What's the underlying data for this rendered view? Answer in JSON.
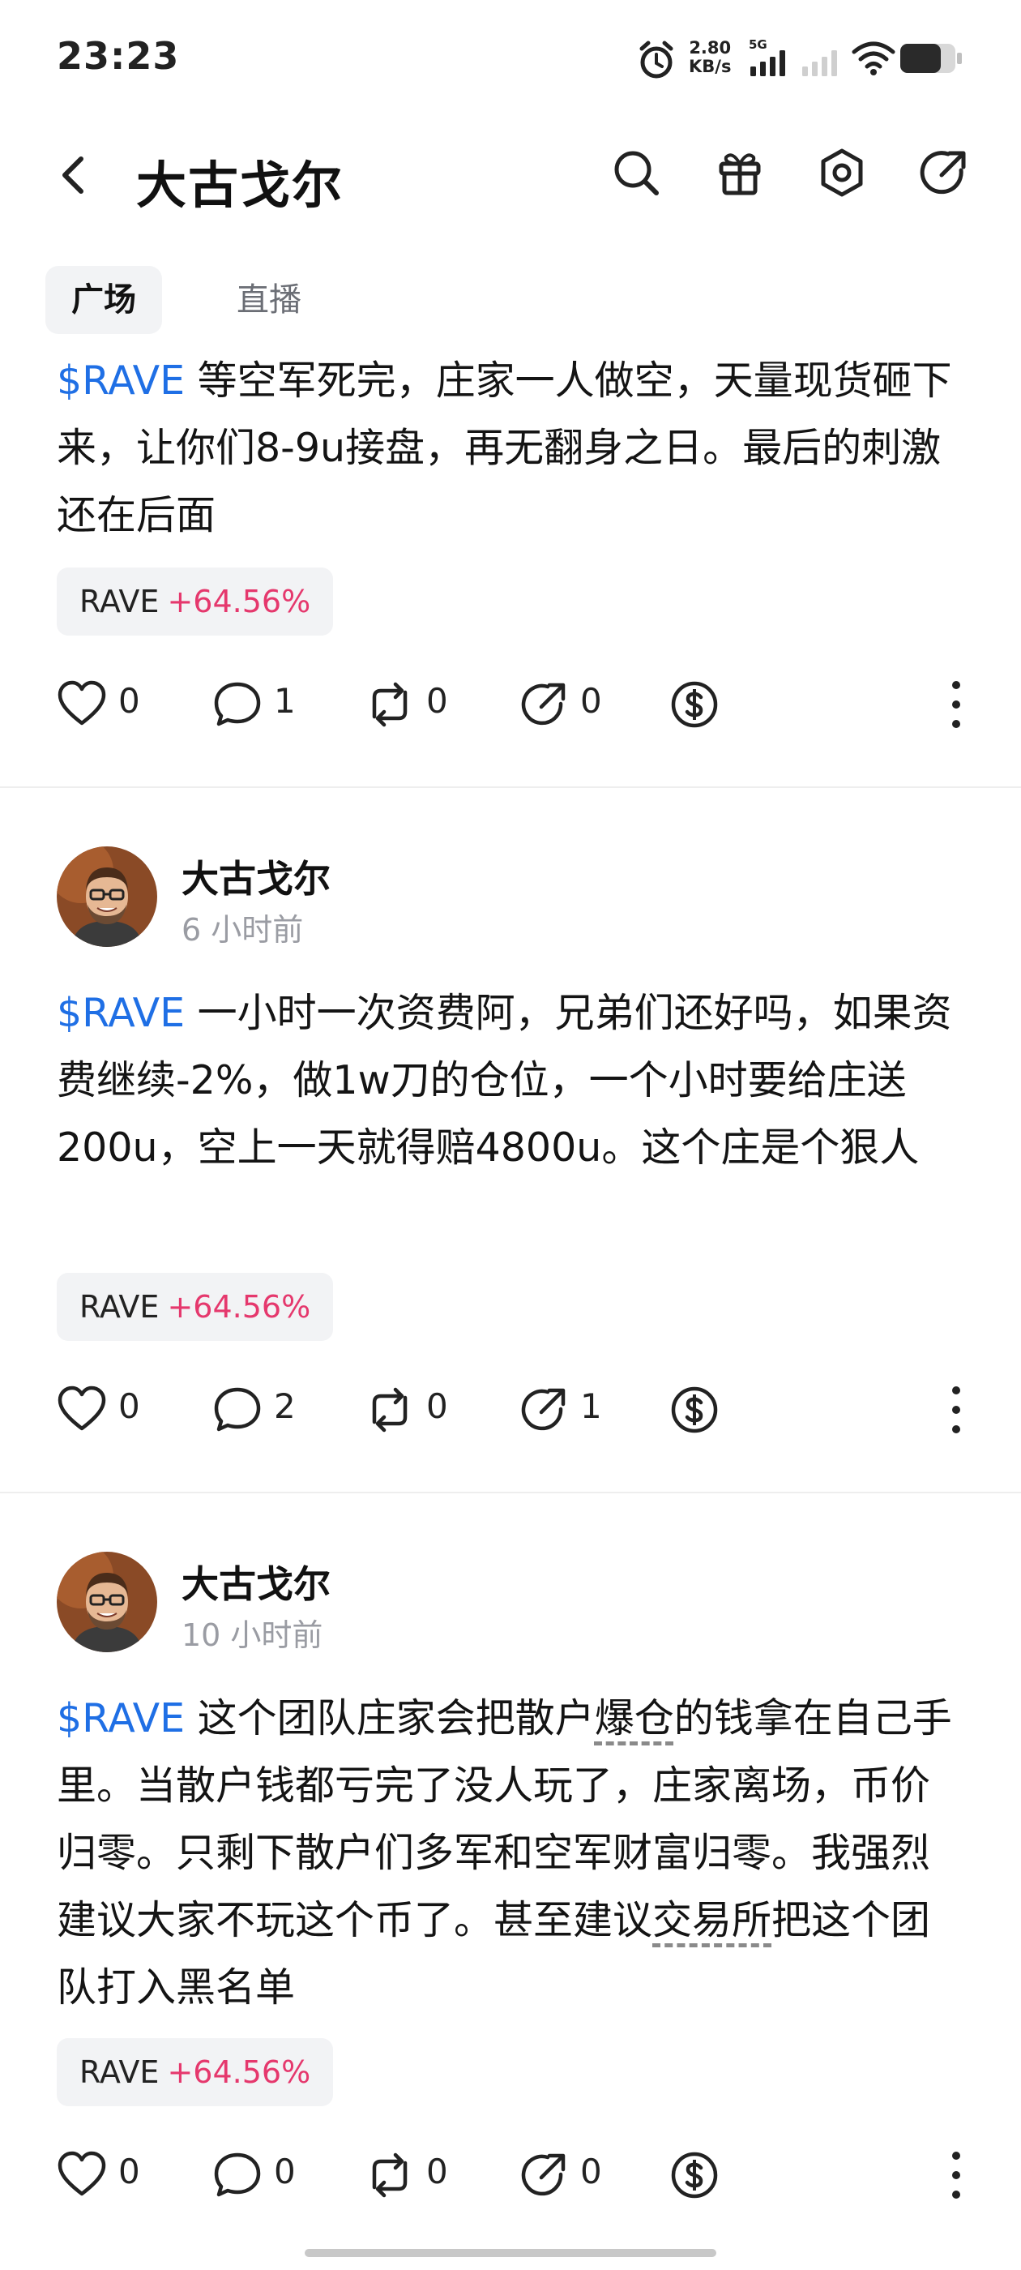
{
  "status_bar": {
    "time": "23:23",
    "speed_value": "2.80",
    "speed_unit": "KB/s",
    "network": "5G",
    "icons": [
      "alarm-icon",
      "signal-5g-icon",
      "signal-sim2-icon",
      "wifi-icon",
      "battery-icon"
    ]
  },
  "header": {
    "title": "大古戈尔",
    "icons": [
      "back-icon",
      "search-icon",
      "gift-icon",
      "settings-icon",
      "share-icon"
    ]
  },
  "tabs": [
    {
      "label": "广场",
      "active": true
    },
    {
      "label": "直播",
      "active": false
    }
  ],
  "colors": {
    "ticker": "#1f6fe5",
    "change_positive": "#e5386d",
    "chip_bg": "#f2f3f5",
    "time_grey": "#9a9ca3"
  },
  "posts": [
    {
      "author": "",
      "time": "",
      "ticker": "$RAVE",
      "text": " 等空军死完，庄家一人做空，天量现货砸下来，让你们8-9u接盘，再无翻身之日。最后的刺激还在后面",
      "chip": {
        "symbol": "RAVE",
        "change": "+64.56%"
      },
      "likes": "0",
      "comments": "1",
      "reposts": "0",
      "shares": "0"
    },
    {
      "author": "大古戈尔",
      "time": "6 小时前",
      "ticker": "$RAVE",
      "text": " 一小时一次资费阿，兄弟们还好吗，如果资费继续-2%，做1w刀的仓位，一个小时要给庄送200u，空上一天就得赔4800u。这个庄是个狠人",
      "chip": {
        "symbol": "RAVE",
        "change": "+64.56%"
      },
      "likes": "0",
      "comments": "2",
      "reposts": "0",
      "shares": "1"
    },
    {
      "author": "大古戈尔",
      "time": "10 小时前",
      "ticker": "$RAVE",
      "text_a": " 这个团队庄家会把散户",
      "text_b": "爆仓",
      "text_c": "的钱拿在自己手里。当散户钱都亏完了没人玩了，庄家离场，币价归零。只剩下散户们多军和空军财富归零。我强烈建议大家不玩这个币了。甚至建议",
      "text_d": "交易所",
      "text_e": "把这个团队打入黑名单",
      "chip": {
        "symbol": "RAVE",
        "change": "+64.56%"
      },
      "likes": "0",
      "comments": "0",
      "reposts": "0",
      "shares": "0"
    }
  ]
}
